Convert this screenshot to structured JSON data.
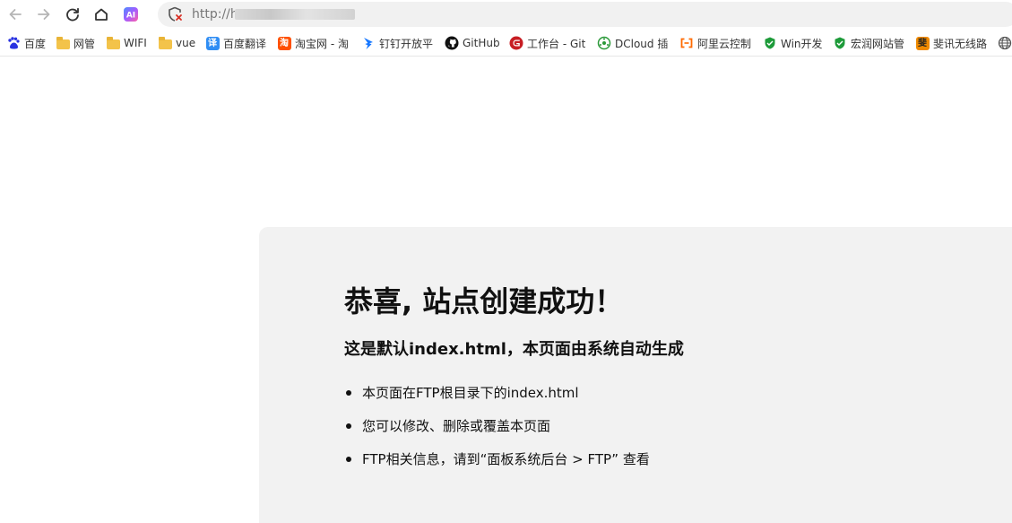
{
  "browser": {
    "address_prefix": "http://h",
    "bookmarks": [
      {
        "label": "百度",
        "icon": "baidu-paw-icon"
      },
      {
        "label": "网管",
        "icon": "folder-icon"
      },
      {
        "label": "WIFI",
        "icon": "folder-icon"
      },
      {
        "label": "vue",
        "icon": "folder-icon"
      },
      {
        "label": "百度翻译",
        "icon": "translate-icon"
      },
      {
        "label": "淘宝网 - 淘",
        "icon": "taobao-icon"
      },
      {
        "label": "钉钉开放平",
        "icon": "dingtalk-icon"
      },
      {
        "label": "GitHub",
        "icon": "github-icon"
      },
      {
        "label": "工作台 - Git",
        "icon": "gitee-icon"
      },
      {
        "label": "DCloud 插",
        "icon": "dcloud-icon"
      },
      {
        "label": "阿里云控制",
        "icon": "aliyun-icon"
      },
      {
        "label": "Win开发",
        "icon": "shield-icon"
      },
      {
        "label": "宏润网站管",
        "icon": "shield-icon"
      },
      {
        "label": "斐讯无线路",
        "icon": "phicomm-icon"
      },
      {
        "label": "",
        "icon": "globe-icon"
      }
    ]
  },
  "page": {
    "title": "恭喜, 站点创建成功！",
    "subtitle": "这是默认index.html，本页面由系统自动生成",
    "items": [
      "本页面在FTP根目录下的index.html",
      "您可以修改、删除或覆盖本页面",
      "FTP相关信息，请到“面板系统后台 > FTP” 查看"
    ]
  }
}
